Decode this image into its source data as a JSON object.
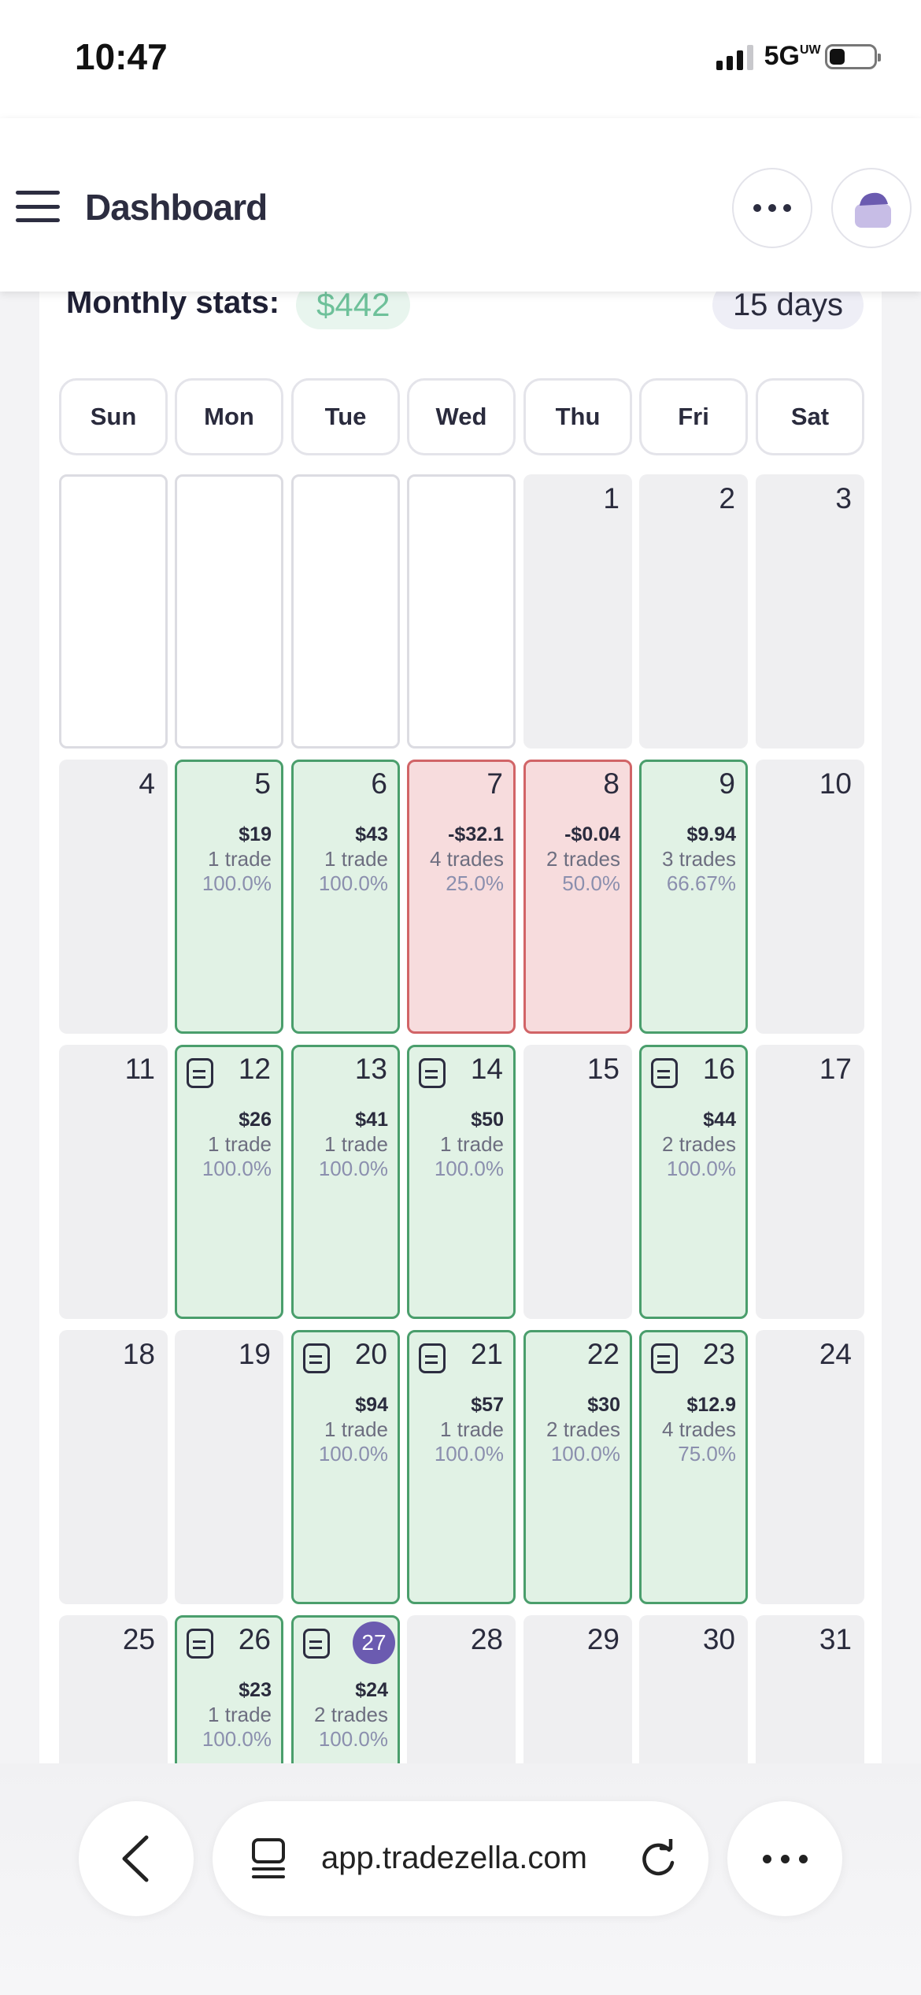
{
  "status_bar": {
    "time": "10:47",
    "network": "5G",
    "network_suffix": "UW"
  },
  "header": {
    "title": "Dashboard"
  },
  "stats": {
    "label": "Monthly stats:",
    "value": "$442",
    "days": "15 days"
  },
  "weekdays": [
    "Sun",
    "Mon",
    "Tue",
    "Wed",
    "Thu",
    "Fri",
    "Sat"
  ],
  "weeks": [
    [
      {
        "type": "empty"
      },
      {
        "type": "empty"
      },
      {
        "type": "empty"
      },
      {
        "type": "empty"
      },
      {
        "day": "1",
        "type": "none"
      },
      {
        "day": "2",
        "type": "none"
      },
      {
        "day": "3",
        "type": "none"
      }
    ],
    [
      {
        "day": "4",
        "type": "none"
      },
      {
        "day": "5",
        "type": "profit",
        "pnl": "$19",
        "trades": "1 trade",
        "win_rate": "100.0%"
      },
      {
        "day": "6",
        "type": "profit",
        "pnl": "$43",
        "trades": "1 trade",
        "win_rate": "100.0%"
      },
      {
        "day": "7",
        "type": "loss",
        "pnl": "-$32.1",
        "trades": "4 trades",
        "win_rate": "25.0%"
      },
      {
        "day": "8",
        "type": "loss",
        "pnl": "-$0.04",
        "trades": "2 trades",
        "win_rate": "50.0%"
      },
      {
        "day": "9",
        "type": "profit",
        "pnl": "$9.94",
        "trades": "3 trades",
        "win_rate": "66.67%"
      },
      {
        "day": "10",
        "type": "none"
      }
    ],
    [
      {
        "day": "11",
        "type": "none"
      },
      {
        "day": "12",
        "type": "profit",
        "note": true,
        "pnl": "$26",
        "trades": "1 trade",
        "win_rate": "100.0%"
      },
      {
        "day": "13",
        "type": "profit",
        "pnl": "$41",
        "trades": "1 trade",
        "win_rate": "100.0%"
      },
      {
        "day": "14",
        "type": "profit",
        "note": true,
        "pnl": "$50",
        "trades": "1 trade",
        "win_rate": "100.0%"
      },
      {
        "day": "15",
        "type": "none"
      },
      {
        "day": "16",
        "type": "profit",
        "note": true,
        "pnl": "$44",
        "trades": "2 trades",
        "win_rate": "100.0%"
      },
      {
        "day": "17",
        "type": "none"
      }
    ],
    [
      {
        "day": "18",
        "type": "none"
      },
      {
        "day": "19",
        "type": "none"
      },
      {
        "day": "20",
        "type": "profit",
        "note": true,
        "pnl": "$94",
        "trades": "1 trade",
        "win_rate": "100.0%"
      },
      {
        "day": "21",
        "type": "profit",
        "note": true,
        "pnl": "$57",
        "trades": "1 trade",
        "win_rate": "100.0%"
      },
      {
        "day": "22",
        "type": "profit",
        "pnl": "$30",
        "trades": "2 trades",
        "win_rate": "100.0%"
      },
      {
        "day": "23",
        "type": "profit",
        "note": true,
        "pnl": "$12.9",
        "trades": "4 trades",
        "win_rate": "75.0%"
      },
      {
        "day": "24",
        "type": "none"
      }
    ],
    [
      {
        "day": "25",
        "type": "none"
      },
      {
        "day": "26",
        "type": "profit",
        "note": true,
        "pnl": "$23",
        "trades": "1 trade",
        "win_rate": "100.0%"
      },
      {
        "day": "27",
        "type": "profit",
        "note": true,
        "today": true,
        "pnl": "$24",
        "trades": "2 trades",
        "win_rate": "100.0%"
      },
      {
        "day": "28",
        "type": "none"
      },
      {
        "day": "29",
        "type": "none"
      },
      {
        "day": "30",
        "type": "none"
      },
      {
        "day": "31",
        "type": "none"
      }
    ]
  ],
  "browser": {
    "url": "app.tradezella.com"
  },
  "colors": {
    "profit_bg": "#e1f2e5",
    "profit_border": "#4a9e6c",
    "loss_bg": "#f7dcdd",
    "loss_border": "#d16467",
    "accent": "#6b5bb0",
    "stat_green": "#6ec19a"
  }
}
